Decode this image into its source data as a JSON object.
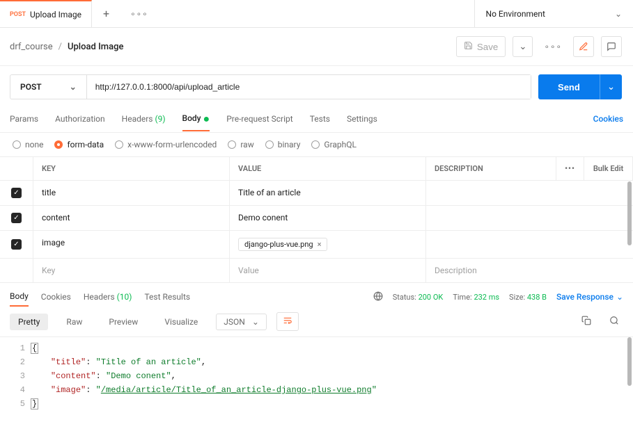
{
  "tabs": {
    "method": "POST",
    "title": "Upload Image"
  },
  "env": {
    "label": "No Environment"
  },
  "breadcrumb": {
    "parent": "drf_course",
    "sep": "/",
    "current": "Upload Image"
  },
  "save_label": "Save",
  "request": {
    "method": "POST",
    "url": "http://127.0.0.1:8000/api/upload_article",
    "send_label": "Send"
  },
  "req_tabs": {
    "params": "Params",
    "auth": "Authorization",
    "headers": "Headers",
    "headers_count": "(9)",
    "body": "Body",
    "prerequest": "Pre-request Script",
    "tests": "Tests",
    "settings": "Settings",
    "cookies": "Cookies"
  },
  "body_types": {
    "none": "none",
    "formdata": "form-data",
    "xwww": "x-www-form-urlencoded",
    "raw": "raw",
    "binary": "binary",
    "graphql": "GraphQL"
  },
  "kv": {
    "head_key": "KEY",
    "head_value": "VALUE",
    "head_desc": "DESCRIPTION",
    "bulk": "Bulk Edit",
    "rows": [
      {
        "key": "title",
        "value": "Title of an article"
      },
      {
        "key": "content",
        "value": "Demo conent"
      },
      {
        "key": "image",
        "file": "django-plus-vue.png"
      }
    ],
    "ph_key": "Key",
    "ph_value": "Value",
    "ph_desc": "Description"
  },
  "resp_tabs": {
    "body": "Body",
    "cookies": "Cookies",
    "headers": "Headers",
    "headers_count": "(10)",
    "tests": "Test Results"
  },
  "resp_meta": {
    "status_label": "Status:",
    "status_value": "200 OK",
    "time_label": "Time:",
    "time_value": "232 ms",
    "size_label": "Size:",
    "size_value": "438 B",
    "save_label": "Save Response"
  },
  "views": {
    "pretty": "Pretty",
    "raw": "Raw",
    "preview": "Preview",
    "visualize": "Visualize",
    "format": "JSON"
  },
  "json": {
    "title_key": "\"title\"",
    "title_val": "\"Title of an article\"",
    "content_key": "\"content\"",
    "content_val": "\"Demo conent\"",
    "image_key": "\"image\"",
    "image_val_q": "\"",
    "image_val_lnk": "/media/article/Title_of_an_article-django-plus-vue.png",
    "image_val_q2": "\"",
    "lbrace": "{",
    "rbrace": "}",
    "colon": ": ",
    "comma": ","
  },
  "lines": {
    "l1": "1",
    "l2": "2",
    "l3": "3",
    "l4": "4",
    "l5": "5"
  }
}
